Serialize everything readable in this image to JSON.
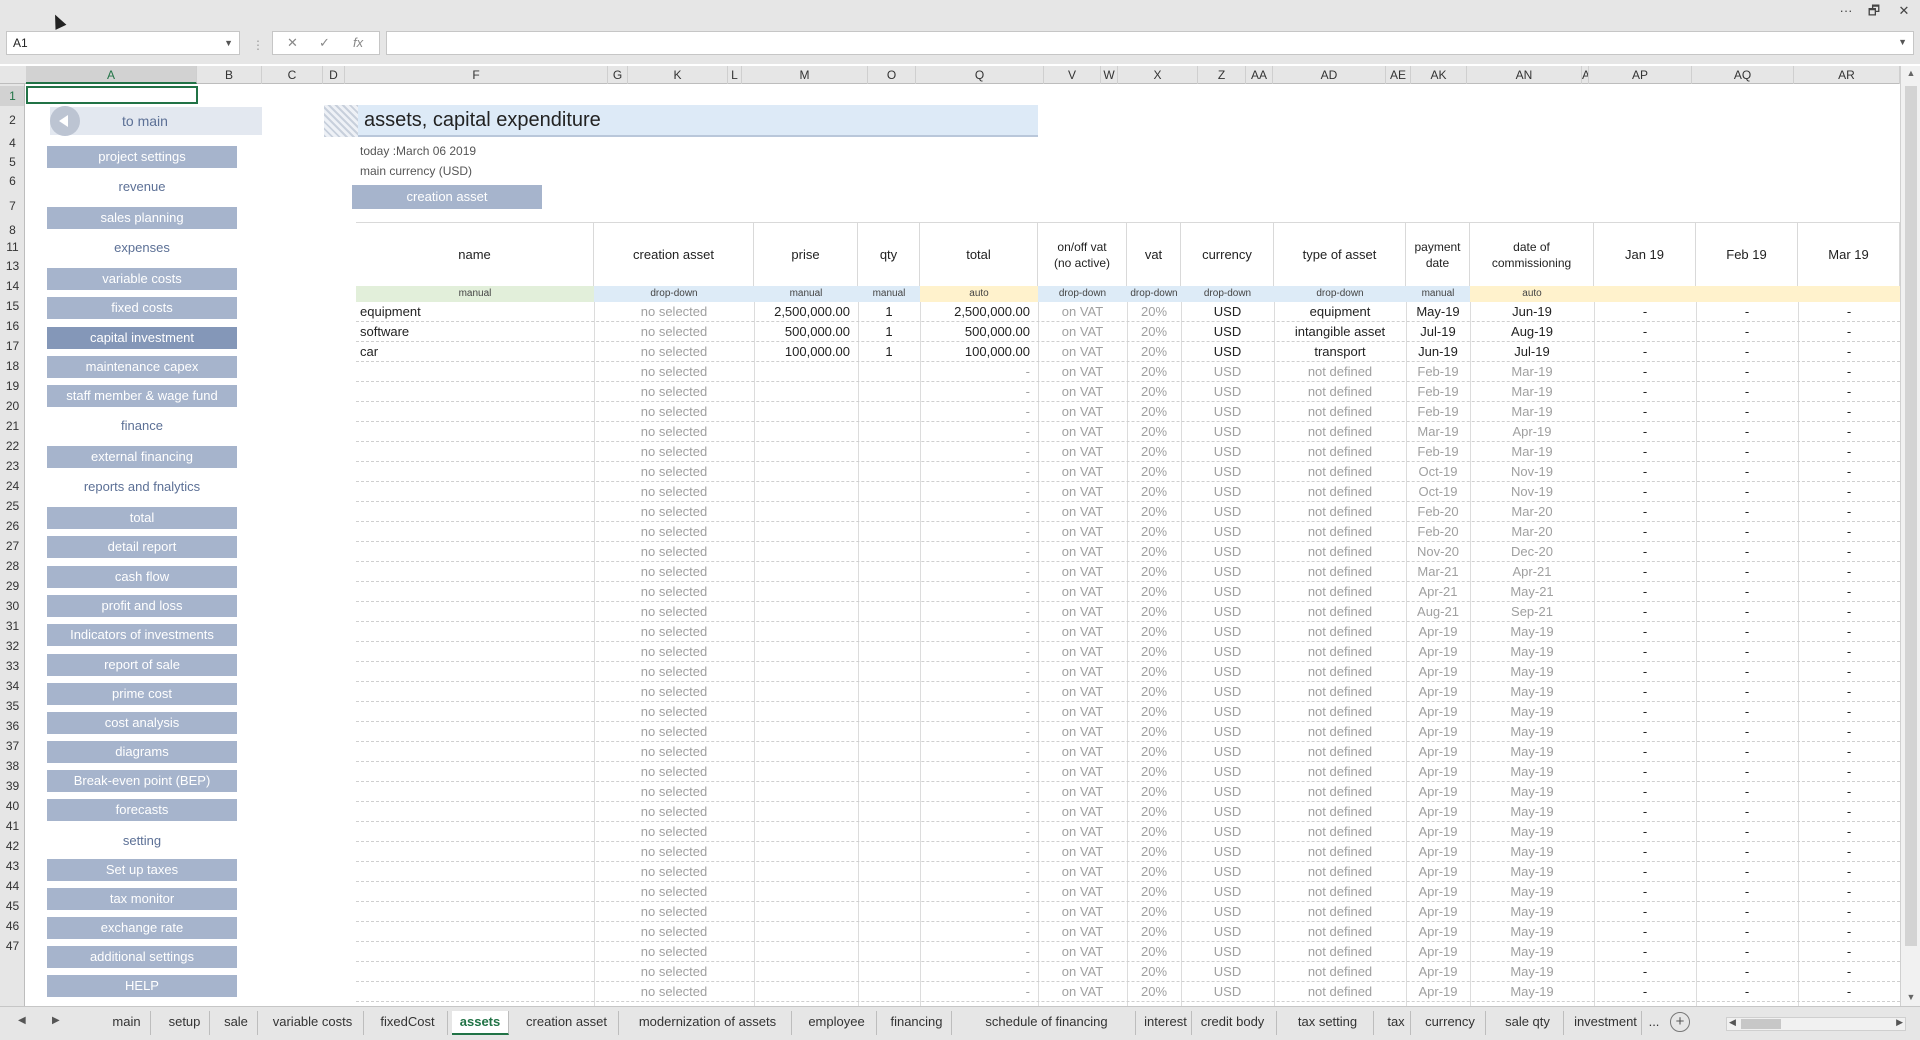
{
  "window": {
    "more_label": "···",
    "restore_label": "🗗",
    "close_label": "✕"
  },
  "formula_bar": {
    "name_box_value": "A1",
    "cancel_label": "✕",
    "enter_label": "✓",
    "fx_label": "fx",
    "formula_value": ""
  },
  "columns": [
    "A",
    "B",
    "C",
    "D",
    "F",
    "G",
    "K",
    "L",
    "M",
    "O",
    "Q",
    "V",
    "W",
    "X",
    "Z",
    "AA",
    "AD",
    "AE",
    "AK",
    "AN",
    "A",
    "AP",
    "AQ",
    "AR"
  ],
  "rows": [
    "1",
    "2",
    "4",
    "5",
    "6",
    "7",
    "8",
    "11",
    "13",
    "14",
    "15",
    "16",
    "17",
    "18",
    "19",
    "20",
    "21",
    "22",
    "23",
    "24",
    "25",
    "26",
    "27",
    "28",
    "29",
    "30",
    "31",
    "32",
    "33",
    "34",
    "35",
    "36",
    "37",
    "38",
    "39",
    "40",
    "41",
    "42",
    "43",
    "44",
    "45",
    "46",
    "47"
  ],
  "sidebar": {
    "to_main": "to main",
    "items": [
      {
        "type": "button",
        "label": "project settings"
      },
      {
        "type": "section",
        "label": "revenue"
      },
      {
        "type": "button",
        "label": "sales planning"
      },
      {
        "type": "section",
        "label": "expenses"
      },
      {
        "type": "button",
        "label": "variable costs"
      },
      {
        "type": "button",
        "label": "fixed costs"
      },
      {
        "type": "button",
        "label": "capital investment",
        "active": true
      },
      {
        "type": "button",
        "label": "maintenance capex"
      },
      {
        "type": "button",
        "label": "staff member & wage fund"
      },
      {
        "type": "section",
        "label": "finance"
      },
      {
        "type": "button",
        "label": "external financing"
      },
      {
        "type": "section",
        "label": "reports and fnalytics"
      },
      {
        "type": "button",
        "label": "total"
      },
      {
        "type": "button",
        "label": "detail report"
      },
      {
        "type": "button",
        "label": "cash flow"
      },
      {
        "type": "button",
        "label": "profit and loss"
      },
      {
        "type": "button",
        "label": "Indicators of investments"
      },
      {
        "type": "button",
        "label": "report of sale"
      },
      {
        "type": "button",
        "label": "prime cost"
      },
      {
        "type": "button",
        "label": "cost analysis"
      },
      {
        "type": "button",
        "label": "diagrams"
      },
      {
        "type": "button",
        "label": "Break-even point (BEP)"
      },
      {
        "type": "button",
        "label": "forecasts"
      },
      {
        "type": "section",
        "label": "setting"
      },
      {
        "type": "button",
        "label": "Set up taxes"
      },
      {
        "type": "button",
        "label": "tax monitor"
      },
      {
        "type": "button",
        "label": "exchange rate"
      },
      {
        "type": "button",
        "label": "additional settings"
      },
      {
        "type": "button",
        "label": "HELP"
      }
    ]
  },
  "header": {
    "title": "assets, capital expenditure",
    "today": "today :March 06 2019",
    "main_currency": "main currency (USD)",
    "create_button": "creation asset"
  },
  "table": {
    "headers": [
      "name",
      "creation asset",
      "prise",
      "qty",
      "total",
      "on/off vat\n(no active)",
      "vat",
      "currency",
      "type of asset",
      "payment\ndate",
      "date of\ncommissioning",
      "Jan 19",
      "Feb 19",
      "Mar 19"
    ],
    "input_types": [
      "manual",
      "drop-down",
      "manual",
      "manual",
      "auto",
      "drop-down",
      "drop-down",
      "drop-down",
      "drop-down",
      "manual",
      "auto",
      "",
      "",
      ""
    ],
    "rows": [
      {
        "name": "equipment",
        "creation": "no selected",
        "prise": "2,500,000.00",
        "qty": "1",
        "total": "2,500,000.00",
        "vat_onoff": "on VAT",
        "vat": "20%",
        "currency": "USD",
        "type": "equipment",
        "payment": "May-19",
        "commission": "Jun-19",
        "m1": "-",
        "m2": "-",
        "m3": "-",
        "active": true
      },
      {
        "name": "software",
        "creation": "no selected",
        "prise": "500,000.00",
        "qty": "1",
        "total": "500,000.00",
        "vat_onoff": "on VAT",
        "vat": "20%",
        "currency": "USD",
        "type": "intangible asset",
        "payment": "Jul-19",
        "commission": "Aug-19",
        "m1": "-",
        "m2": "-",
        "m3": "-",
        "active": true
      },
      {
        "name": "car",
        "creation": "no selected",
        "prise": "100,000.00",
        "qty": "1",
        "total": "100,000.00",
        "vat_onoff": "on VAT",
        "vat": "20%",
        "currency": "USD",
        "type": "transport",
        "payment": "Jun-19",
        "commission": "Jul-19",
        "m1": "-",
        "m2": "-",
        "m3": "-",
        "active": true
      },
      {
        "name": "",
        "creation": "no selected",
        "prise": "",
        "qty": "",
        "total": "-",
        "vat_onoff": "on VAT",
        "vat": "20%",
        "currency": "USD",
        "type": "not defined",
        "payment": "Feb-19",
        "commission": "Mar-19",
        "m1": "-",
        "m2": "-",
        "m3": "-"
      },
      {
        "name": "",
        "creation": "no selected",
        "prise": "",
        "qty": "",
        "total": "-",
        "vat_onoff": "on VAT",
        "vat": "20%",
        "currency": "USD",
        "type": "not defined",
        "payment": "Feb-19",
        "commission": "Mar-19",
        "m1": "-",
        "m2": "-",
        "m3": "-"
      },
      {
        "name": "",
        "creation": "no selected",
        "prise": "",
        "qty": "",
        "total": "-",
        "vat_onoff": "on VAT",
        "vat": "20%",
        "currency": "USD",
        "type": "not defined",
        "payment": "Feb-19",
        "commission": "Mar-19",
        "m1": "-",
        "m2": "-",
        "m3": "-"
      },
      {
        "name": "",
        "creation": "no selected",
        "prise": "",
        "qty": "",
        "total": "-",
        "vat_onoff": "on VAT",
        "vat": "20%",
        "currency": "USD",
        "type": "not defined",
        "payment": "Mar-19",
        "commission": "Apr-19",
        "m1": "-",
        "m2": "-",
        "m3": "-"
      },
      {
        "name": "",
        "creation": "no selected",
        "prise": "",
        "qty": "",
        "total": "-",
        "vat_onoff": "on VAT",
        "vat": "20%",
        "currency": "USD",
        "type": "not defined",
        "payment": "Feb-19",
        "commission": "Mar-19",
        "m1": "-",
        "m2": "-",
        "m3": "-"
      },
      {
        "name": "",
        "creation": "no selected",
        "prise": "",
        "qty": "",
        "total": "-",
        "vat_onoff": "on VAT",
        "vat": "20%",
        "currency": "USD",
        "type": "not defined",
        "payment": "Oct-19",
        "commission": "Nov-19",
        "m1": "-",
        "m2": "-",
        "m3": "-"
      },
      {
        "name": "",
        "creation": "no selected",
        "prise": "",
        "qty": "",
        "total": "-",
        "vat_onoff": "on VAT",
        "vat": "20%",
        "currency": "USD",
        "type": "not defined",
        "payment": "Oct-19",
        "commission": "Nov-19",
        "m1": "-",
        "m2": "-",
        "m3": "-"
      },
      {
        "name": "",
        "creation": "no selected",
        "prise": "",
        "qty": "",
        "total": "-",
        "vat_onoff": "on VAT",
        "vat": "20%",
        "currency": "USD",
        "type": "not defined",
        "payment": "Feb-20",
        "commission": "Mar-20",
        "m1": "-",
        "m2": "-",
        "m3": "-"
      },
      {
        "name": "",
        "creation": "no selected",
        "prise": "",
        "qty": "",
        "total": "-",
        "vat_onoff": "on VAT",
        "vat": "20%",
        "currency": "USD",
        "type": "not defined",
        "payment": "Feb-20",
        "commission": "Mar-20",
        "m1": "-",
        "m2": "-",
        "m3": "-"
      },
      {
        "name": "",
        "creation": "no selected",
        "prise": "",
        "qty": "",
        "total": "-",
        "vat_onoff": "on VAT",
        "vat": "20%",
        "currency": "USD",
        "type": "not defined",
        "payment": "Nov-20",
        "commission": "Dec-20",
        "m1": "-",
        "m2": "-",
        "m3": "-"
      },
      {
        "name": "",
        "creation": "no selected",
        "prise": "",
        "qty": "",
        "total": "-",
        "vat_onoff": "on VAT",
        "vat": "20%",
        "currency": "USD",
        "type": "not defined",
        "payment": "Mar-21",
        "commission": "Apr-21",
        "m1": "-",
        "m2": "-",
        "m3": "-"
      },
      {
        "name": "",
        "creation": "no selected",
        "prise": "",
        "qty": "",
        "total": "-",
        "vat_onoff": "on VAT",
        "vat": "20%",
        "currency": "USD",
        "type": "not defined",
        "payment": "Apr-21",
        "commission": "May-21",
        "m1": "-",
        "m2": "-",
        "m3": "-"
      },
      {
        "name": "",
        "creation": "no selected",
        "prise": "",
        "qty": "",
        "total": "-",
        "vat_onoff": "on VAT",
        "vat": "20%",
        "currency": "USD",
        "type": "not defined",
        "payment": "Aug-21",
        "commission": "Sep-21",
        "m1": "-",
        "m2": "-",
        "m3": "-"
      },
      {
        "name": "",
        "creation": "no selected",
        "prise": "",
        "qty": "",
        "total": "-",
        "vat_onoff": "on VAT",
        "vat": "20%",
        "currency": "USD",
        "type": "not defined",
        "payment": "Apr-19",
        "commission": "May-19",
        "m1": "-",
        "m2": "-",
        "m3": "-"
      },
      {
        "name": "",
        "creation": "no selected",
        "prise": "",
        "qty": "",
        "total": "-",
        "vat_onoff": "on VAT",
        "vat": "20%",
        "currency": "USD",
        "type": "not defined",
        "payment": "Apr-19",
        "commission": "May-19",
        "m1": "-",
        "m2": "-",
        "m3": "-"
      },
      {
        "name": "",
        "creation": "no selected",
        "prise": "",
        "qty": "",
        "total": "-",
        "vat_onoff": "on VAT",
        "vat": "20%",
        "currency": "USD",
        "type": "not defined",
        "payment": "Apr-19",
        "commission": "May-19",
        "m1": "-",
        "m2": "-",
        "m3": "-"
      },
      {
        "name": "",
        "creation": "no selected",
        "prise": "",
        "qty": "",
        "total": "-",
        "vat_onoff": "on VAT",
        "vat": "20%",
        "currency": "USD",
        "type": "not defined",
        "payment": "Apr-19",
        "commission": "May-19",
        "m1": "-",
        "m2": "-",
        "m3": "-"
      },
      {
        "name": "",
        "creation": "no selected",
        "prise": "",
        "qty": "",
        "total": "-",
        "vat_onoff": "on VAT",
        "vat": "20%",
        "currency": "USD",
        "type": "not defined",
        "payment": "Apr-19",
        "commission": "May-19",
        "m1": "-",
        "m2": "-",
        "m3": "-"
      },
      {
        "name": "",
        "creation": "no selected",
        "prise": "",
        "qty": "",
        "total": "-",
        "vat_onoff": "on VAT",
        "vat": "20%",
        "currency": "USD",
        "type": "not defined",
        "payment": "Apr-19",
        "commission": "May-19",
        "m1": "-",
        "m2": "-",
        "m3": "-"
      },
      {
        "name": "",
        "creation": "no selected",
        "prise": "",
        "qty": "",
        "total": "-",
        "vat_onoff": "on VAT",
        "vat": "20%",
        "currency": "USD",
        "type": "not defined",
        "payment": "Apr-19",
        "commission": "May-19",
        "m1": "-",
        "m2": "-",
        "m3": "-"
      },
      {
        "name": "",
        "creation": "no selected",
        "prise": "",
        "qty": "",
        "total": "-",
        "vat_onoff": "on VAT",
        "vat": "20%",
        "currency": "USD",
        "type": "not defined",
        "payment": "Apr-19",
        "commission": "May-19",
        "m1": "-",
        "m2": "-",
        "m3": "-"
      },
      {
        "name": "",
        "creation": "no selected",
        "prise": "",
        "qty": "",
        "total": "-",
        "vat_onoff": "on VAT",
        "vat": "20%",
        "currency": "USD",
        "type": "not defined",
        "payment": "Apr-19",
        "commission": "May-19",
        "m1": "-",
        "m2": "-",
        "m3": "-"
      },
      {
        "name": "",
        "creation": "no selected",
        "prise": "",
        "qty": "",
        "total": "-",
        "vat_onoff": "on VAT",
        "vat": "20%",
        "currency": "USD",
        "type": "not defined",
        "payment": "Apr-19",
        "commission": "May-19",
        "m1": "-",
        "m2": "-",
        "m3": "-"
      },
      {
        "name": "",
        "creation": "no selected",
        "prise": "",
        "qty": "",
        "total": "-",
        "vat_onoff": "on VAT",
        "vat": "20%",
        "currency": "USD",
        "type": "not defined",
        "payment": "Apr-19",
        "commission": "May-19",
        "m1": "-",
        "m2": "-",
        "m3": "-"
      },
      {
        "name": "",
        "creation": "no selected",
        "prise": "",
        "qty": "",
        "total": "-",
        "vat_onoff": "on VAT",
        "vat": "20%",
        "currency": "USD",
        "type": "not defined",
        "payment": "Apr-19",
        "commission": "May-19",
        "m1": "-",
        "m2": "-",
        "m3": "-"
      },
      {
        "name": "",
        "creation": "no selected",
        "prise": "",
        "qty": "",
        "total": "-",
        "vat_onoff": "on VAT",
        "vat": "20%",
        "currency": "USD",
        "type": "not defined",
        "payment": "Apr-19",
        "commission": "May-19",
        "m1": "-",
        "m2": "-",
        "m3": "-"
      },
      {
        "name": "",
        "creation": "no selected",
        "prise": "",
        "qty": "",
        "total": "-",
        "vat_onoff": "on VAT",
        "vat": "20%",
        "currency": "USD",
        "type": "not defined",
        "payment": "Apr-19",
        "commission": "May-19",
        "m1": "-",
        "m2": "-",
        "m3": "-"
      },
      {
        "name": "",
        "creation": "no selected",
        "prise": "",
        "qty": "",
        "total": "-",
        "vat_onoff": "on VAT",
        "vat": "20%",
        "currency": "USD",
        "type": "not defined",
        "payment": "Apr-19",
        "commission": "May-19",
        "m1": "-",
        "m2": "-",
        "m3": "-"
      },
      {
        "name": "",
        "creation": "no selected",
        "prise": "",
        "qty": "",
        "total": "-",
        "vat_onoff": "on VAT",
        "vat": "20%",
        "currency": "USD",
        "type": "not defined",
        "payment": "Apr-19",
        "commission": "May-19",
        "m1": "-",
        "m2": "-",
        "m3": "-"
      },
      {
        "name": "",
        "creation": "no selected",
        "prise": "",
        "qty": "",
        "total": "-",
        "vat_onoff": "on VAT",
        "vat": "20%",
        "currency": "USD",
        "type": "not defined",
        "payment": "Apr-19",
        "commission": "May-19",
        "m1": "-",
        "m2": "-",
        "m3": "-"
      },
      {
        "name": "",
        "creation": "no selected",
        "prise": "",
        "qty": "",
        "total": "-",
        "vat_onoff": "on VAT",
        "vat": "20%",
        "currency": "USD",
        "type": "not defined",
        "payment": "Apr-19",
        "commission": "May-19",
        "m1": "-",
        "m2": "-",
        "m3": "-"
      },
      {
        "name": "",
        "creation": "no selected",
        "prise": "",
        "qty": "",
        "total": "-",
        "vat_onoff": "on VAT",
        "vat": "20%",
        "currency": "USD",
        "type": "not defined",
        "payment": "Apr-19",
        "commission": "May-19",
        "m1": "-",
        "m2": "-",
        "m3": "-"
      }
    ]
  },
  "sheet_tabs": {
    "tabs": [
      "main",
      "setup",
      "sale",
      "variable costs",
      "fixedCost",
      "assets",
      "creation asset",
      "modernization of assets",
      "employee",
      "financing",
      "schedule of financing",
      "interest",
      "credit body",
      "tax setting",
      "tax",
      "currency",
      "sale qty",
      "investment"
    ],
    "active": "assets",
    "more_label": "...",
    "add_label": "+"
  }
}
